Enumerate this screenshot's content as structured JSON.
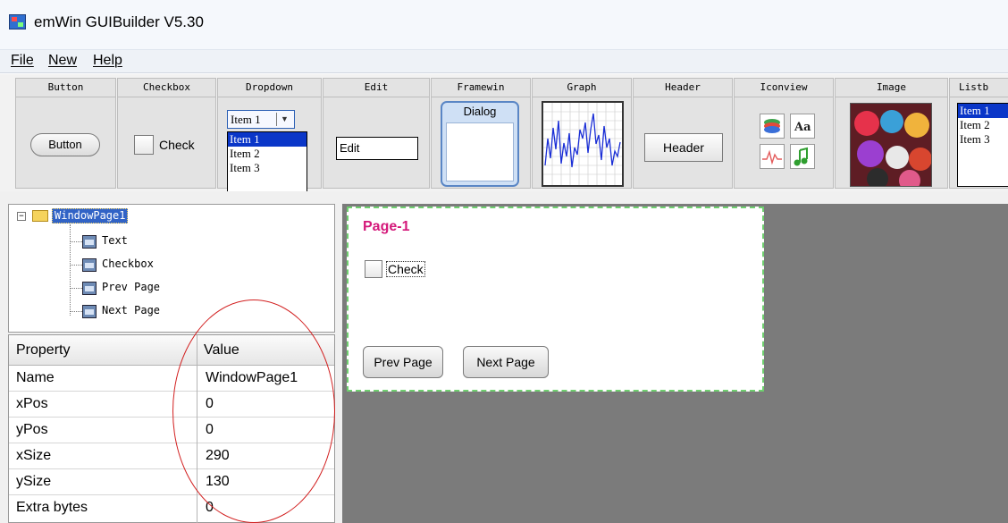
{
  "window": {
    "title": "emWin GUIBuilder V5.30"
  },
  "menu": {
    "items": [
      "File",
      "New",
      "Help"
    ]
  },
  "toolbar": {
    "tools": [
      "Button",
      "Checkbox",
      "Dropdown",
      "Edit",
      "Framewin",
      "Graph",
      "Header",
      "Iconview",
      "Image",
      "Listb"
    ],
    "button_label": "Button",
    "checkbox_label": "Check",
    "dropdown": {
      "selected": "Item 1",
      "options": [
        "Item 1",
        "Item 2",
        "Item 3"
      ]
    },
    "edit_value": "Edit",
    "framewin_title": "Dialog",
    "header_label": "Header",
    "iconview_icons": [
      "stack-icon",
      "font-icon",
      "waveform-icon",
      "music-note-icon"
    ],
    "listbox": {
      "options": [
        "Item 1",
        "Item 2",
        "Item 3"
      ]
    }
  },
  "tree": {
    "root": "WindowPage1",
    "children": [
      "Text",
      "Checkbox",
      "Prev Page",
      "Next Page"
    ]
  },
  "properties": {
    "headers": {
      "property": "Property",
      "value": "Value"
    },
    "rows": [
      {
        "name": "Name",
        "value": "WindowPage1"
      },
      {
        "name": "xPos",
        "value": "0"
      },
      {
        "name": "yPos",
        "value": "0"
      },
      {
        "name": "xSize",
        "value": "290"
      },
      {
        "name": "ySize",
        "value": "130"
      },
      {
        "name": "Extra bytes",
        "value": "0"
      }
    ]
  },
  "page": {
    "title": "Page-1",
    "checkbox_label": "Check",
    "prev_label": "Prev Page",
    "next_label": "Next Page"
  },
  "colors": {
    "page_title": "#d4187a",
    "selection": "#0a36c8",
    "annotation": "#d21f1f",
    "page_border": "#6fcf6f"
  }
}
